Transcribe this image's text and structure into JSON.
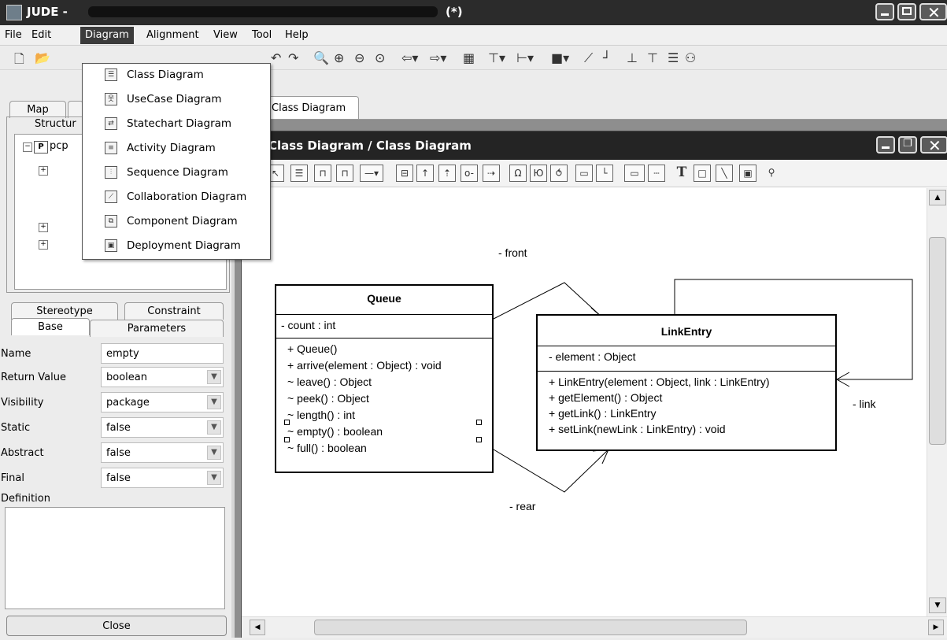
{
  "window": {
    "title": "JUDE -",
    "modified_mark": "(*)"
  },
  "menubar": {
    "items": [
      "File",
      "Edit",
      "Diagram",
      "Alignment",
      "View",
      "Tool",
      "Help"
    ]
  },
  "diagram_menu": {
    "items": [
      {
        "label": "Class Diagram",
        "icon": "class-diagram-icon"
      },
      {
        "label": "UseCase Diagram",
        "icon": "usecase-diagram-icon"
      },
      {
        "label": "Statechart Diagram",
        "icon": "statechart-diagram-icon"
      },
      {
        "label": "Activity Diagram",
        "icon": "activity-diagram-icon"
      },
      {
        "label": "Sequence Diagram",
        "icon": "sequence-diagram-icon"
      },
      {
        "label": "Collaboration Diagram",
        "icon": "collaboration-diagram-icon"
      },
      {
        "label": "Component Diagram",
        "icon": "component-diagram-icon"
      },
      {
        "label": "Deployment Diagram",
        "icon": "deployment-diagram-icon"
      }
    ]
  },
  "left_panel": {
    "top_tabs": [
      "Map",
      "Structur"
    ],
    "tree_root": "pcp",
    "prop_tabs": {
      "stereotype": "Stereotype",
      "constraint": "Constraint",
      "base": "Base",
      "parameters": "Parameters"
    },
    "properties": [
      {
        "label": "Name",
        "value": "empty",
        "dropdown": false
      },
      {
        "label": "Return Value",
        "value": "boolean",
        "dropdown": true
      },
      {
        "label": "Visibility",
        "value": "package",
        "dropdown": true
      },
      {
        "label": "Static",
        "value": "false",
        "dropdown": true
      },
      {
        "label": "Abstract",
        "value": "false",
        "dropdown": true
      },
      {
        "label": "Final",
        "value": "false",
        "dropdown": true
      }
    ],
    "definition_label": "Definition",
    "close_label": "Close"
  },
  "doc_tab": "Class Diagram",
  "inner_window": {
    "title": "Class Diagram / Class Diagram"
  },
  "diagram": {
    "queue": {
      "name": "Queue",
      "attributes": [
        "- count : int"
      ],
      "operations": [
        "+ Queue()",
        "+ arrive(element : Object) : void",
        "~ leave() : Object",
        "~ peek() : Object",
        "~ length() : int",
        "~ empty() : boolean",
        "~ full() : boolean"
      ]
    },
    "linkentry": {
      "name": "LinkEntry",
      "attributes": [
        "- element : Object"
      ],
      "operations": [
        "+ LinkEntry(element : Object, link : LinkEntry)",
        "+ getElement() : Object",
        "+ getLink() : LinkEntry",
        "+ setLink(newLink : LinkEntry) : void"
      ]
    },
    "associations": {
      "front": "- front",
      "rear": "- rear",
      "link": "- link"
    }
  }
}
